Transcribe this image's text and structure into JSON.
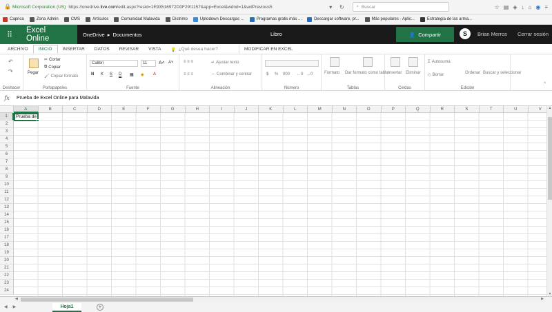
{
  "browser": {
    "site_identity": "Microsoft Corporation (US)",
    "url_prefix": "https://onedrive.",
    "url_domain": "live.com",
    "url_rest": "/edit.aspx?resid=1E93516972D0F29!1157&app=Excel&wdnd=1&wdPrevious5",
    "search_placeholder": "Buscar"
  },
  "bookmarks": [
    {
      "label": "Caprica",
      "color": "#c0392b"
    },
    {
      "label": "Zona Admin",
      "color": "#555555"
    },
    {
      "label": "CMS",
      "color": "#555555"
    },
    {
      "label": "Artículos",
      "color": "#555555"
    },
    {
      "label": "Comunidad Malavida",
      "color": "#555555"
    },
    {
      "label": "Distrimo",
      "color": "#555555"
    },
    {
      "label": "Uptodown Descargas ...",
      "color": "#3b8ed6"
    },
    {
      "label": "Programas gratis más ...",
      "color": "#2a6fb0"
    },
    {
      "label": "Descargar software, pr...",
      "color": "#1f6fd1"
    },
    {
      "label": "Más populares - Aplic...",
      "color": "#555555"
    },
    {
      "label": "Estrategia de las arma...",
      "color": "#333333"
    }
  ],
  "app": {
    "name": "Excel Online",
    "breadcrumb_root": "OneDrive",
    "breadcrumb_sep": "▸",
    "breadcrumb_folder": "Documentos",
    "doc_title": "Libro",
    "share_label": "Compartir",
    "user_name": "Brian Merros",
    "signout_label": "Cerrar sesión",
    "accent": "#217346"
  },
  "tabs": {
    "archivo": "ARCHIVO",
    "inicio": "INICIO",
    "insertar": "INSERTAR",
    "datos": "DATOS",
    "revisar": "REVISAR",
    "vista": "VISTA",
    "tellme": "¿Qué desea hacer?",
    "edit_in_excel": "MODIFICAR EN EXCEL"
  },
  "ribbon": {
    "undo_group": "Deshacer",
    "clipboard_group": "Portapapeles",
    "paste": "Pegar",
    "cut": "Cortar",
    "copy": "Copiar",
    "format_painter": "Copiar formato",
    "font_group": "Fuente",
    "font_name": "Calibri",
    "font_size": "11",
    "bold": "N",
    "italic": "K",
    "underline": "S",
    "double_underline": "D",
    "alignment_group": "Alineación",
    "wrap_text": "Ajustar texto",
    "merge_center": "Combinar y centrar",
    "number_group": "Número",
    "currency": "$",
    "percent": "%",
    "thousands": "000",
    "tables_group": "Tablas",
    "conditional_format": "Formato",
    "format_as_table": "Dar formato como tabla",
    "cells_group": "Celdas",
    "insert": "Insertar",
    "delete": "Eliminar",
    "editing_group": "Edición",
    "autosum": "Autosuma",
    "clear": "Borrar",
    "sort": "Ordenar",
    "find_select": "Buscar y seleccionar"
  },
  "formula": {
    "fx": "fx",
    "value": "Prueba de Excel Online para Malavida"
  },
  "grid": {
    "columns": [
      "A",
      "B",
      "C",
      "D",
      "E",
      "F",
      "G",
      "H",
      "I",
      "J",
      "K",
      "L",
      "M",
      "N",
      "O",
      "P",
      "Q",
      "R",
      "S",
      "T",
      "U",
      "V"
    ],
    "rows": [
      "1",
      "2",
      "3",
      "4",
      "5",
      "6",
      "7",
      "8",
      "9",
      "10",
      "11",
      "12",
      "13",
      "14",
      "15",
      "16",
      "17",
      "18",
      "19",
      "20",
      "21",
      "22",
      "23",
      "24"
    ],
    "active_cell_text": "Prueba de"
  },
  "sheets": {
    "active": "Hoja1",
    "add": "+"
  }
}
